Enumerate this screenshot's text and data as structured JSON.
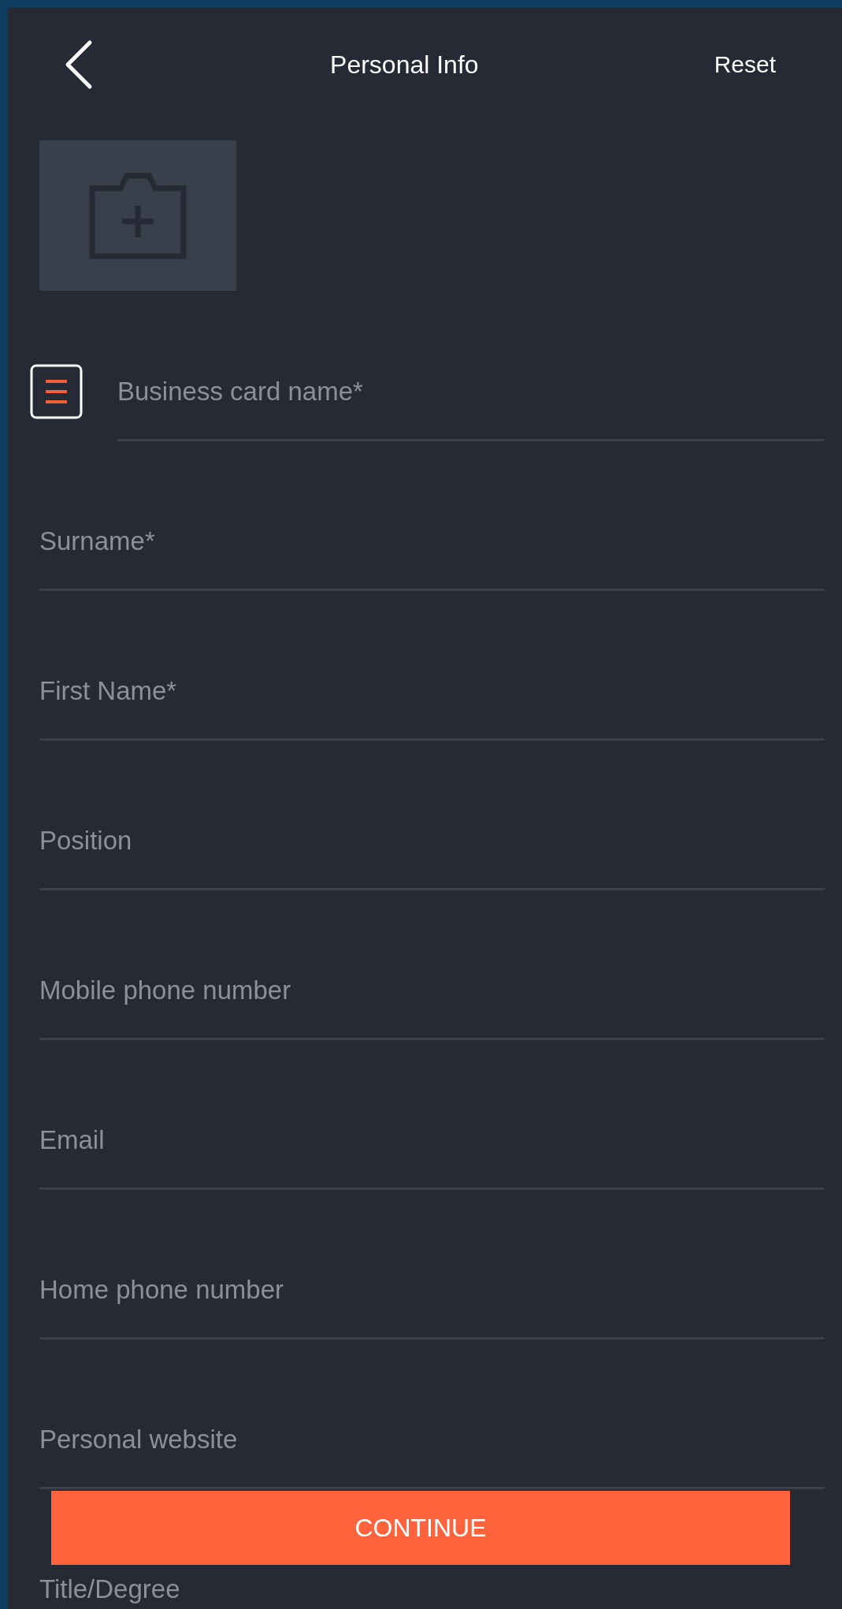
{
  "header": {
    "title": "Personal Info",
    "reset": "Reset"
  },
  "card_field": {
    "placeholder": "Business card name*"
  },
  "fields": [
    {
      "placeholder": "Surname*"
    },
    {
      "placeholder": "First Name*"
    },
    {
      "placeholder": "Position"
    },
    {
      "placeholder": "Mobile phone number"
    },
    {
      "placeholder": "Email"
    },
    {
      "placeholder": "Home phone number"
    },
    {
      "placeholder": "Personal website"
    },
    {
      "placeholder": "Title/Degree"
    }
  ],
  "continue_button": "CONTINUE"
}
